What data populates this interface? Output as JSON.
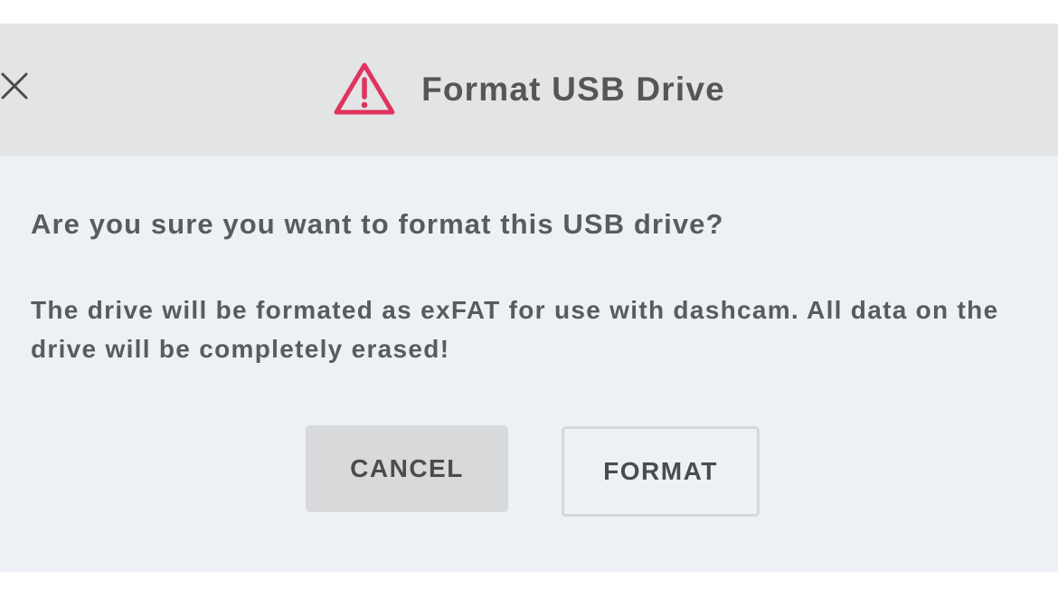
{
  "dialog": {
    "title": "Format USB Drive",
    "close_icon": "close-icon",
    "warning_icon": "warning-triangle-icon",
    "question": "Are you sure you want to format this USB drive?",
    "message": "The drive will be formated as exFAT for use with dashcam. All data on the drive will be completely erased!",
    "buttons": {
      "cancel_label": "CANCEL",
      "format_label": "FORMAT"
    }
  },
  "colors": {
    "warning": "#e0335e",
    "header_bg": "#e3e4e6",
    "body_bg": "#edf1f5",
    "text": "#5a5b5d",
    "cancel_bg": "#d8d9db"
  }
}
